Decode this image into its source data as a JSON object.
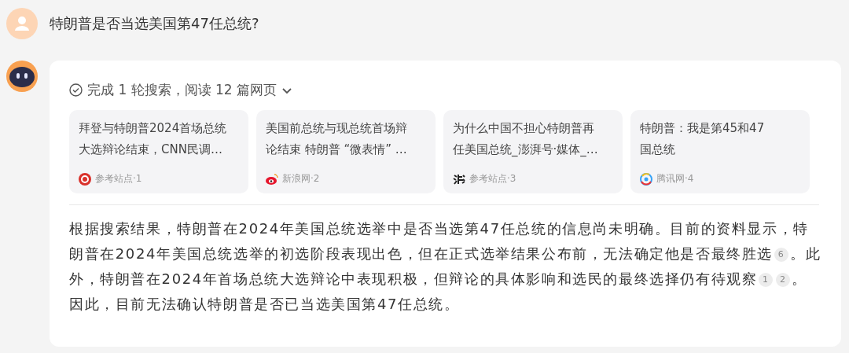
{
  "question": {
    "text": "特朗普是否当选美国第47任总统?"
  },
  "answer": {
    "search_summary": {
      "label": "完成 1 轮搜索，阅读 12 篇网页",
      "expanded": false
    },
    "sources": [
      {
        "title_lines": [
          "拜登与特朗普2024首场总统",
          "大选辩论结束，CNN民调…"
        ],
        "site": "参考站点·1",
        "kind": "guan"
      },
      {
        "title_lines": [
          "美国前总统与现总统首场辩",
          "论结束 特朗普 “微表情” …"
        ],
        "site": "新浪网·2",
        "kind": "weibo"
      },
      {
        "title_lines": [
          "为什么中国不担心特朗普再",
          "任美国总统_澎湃号·媒体_…"
        ],
        "site": "参考站点·3",
        "kind": "peng"
      },
      {
        "title_lines": [
          "特朗普：我是第45和47",
          "国总统"
        ],
        "site": "腾讯网·4",
        "kind": "tencent"
      }
    ],
    "paragraph": [
      {
        "kind": "text",
        "text": "根据搜索结果，特朗普在2024年美国总统选举中是否当选第47任总统的信息尚未明确。目前的资料显示，特朗普在2024年美国总统选举的初选阶段表现出色，但在正式选举结果公布前，无法确定他是否最终胜选"
      },
      {
        "kind": "cite",
        "text": "6"
      },
      {
        "kind": "text",
        "text": "。此外，特朗普在2024年首场总统大选辩论中表现积极，但辩论的具体影响和选民的最终选择仍有待观察"
      },
      {
        "kind": "cite",
        "text": "1"
      },
      {
        "kind": "cite",
        "text": "2"
      },
      {
        "kind": "text",
        "text": "。因此，目前无法确认特朗普是否已当选美国第47任总统。"
      }
    ]
  }
}
